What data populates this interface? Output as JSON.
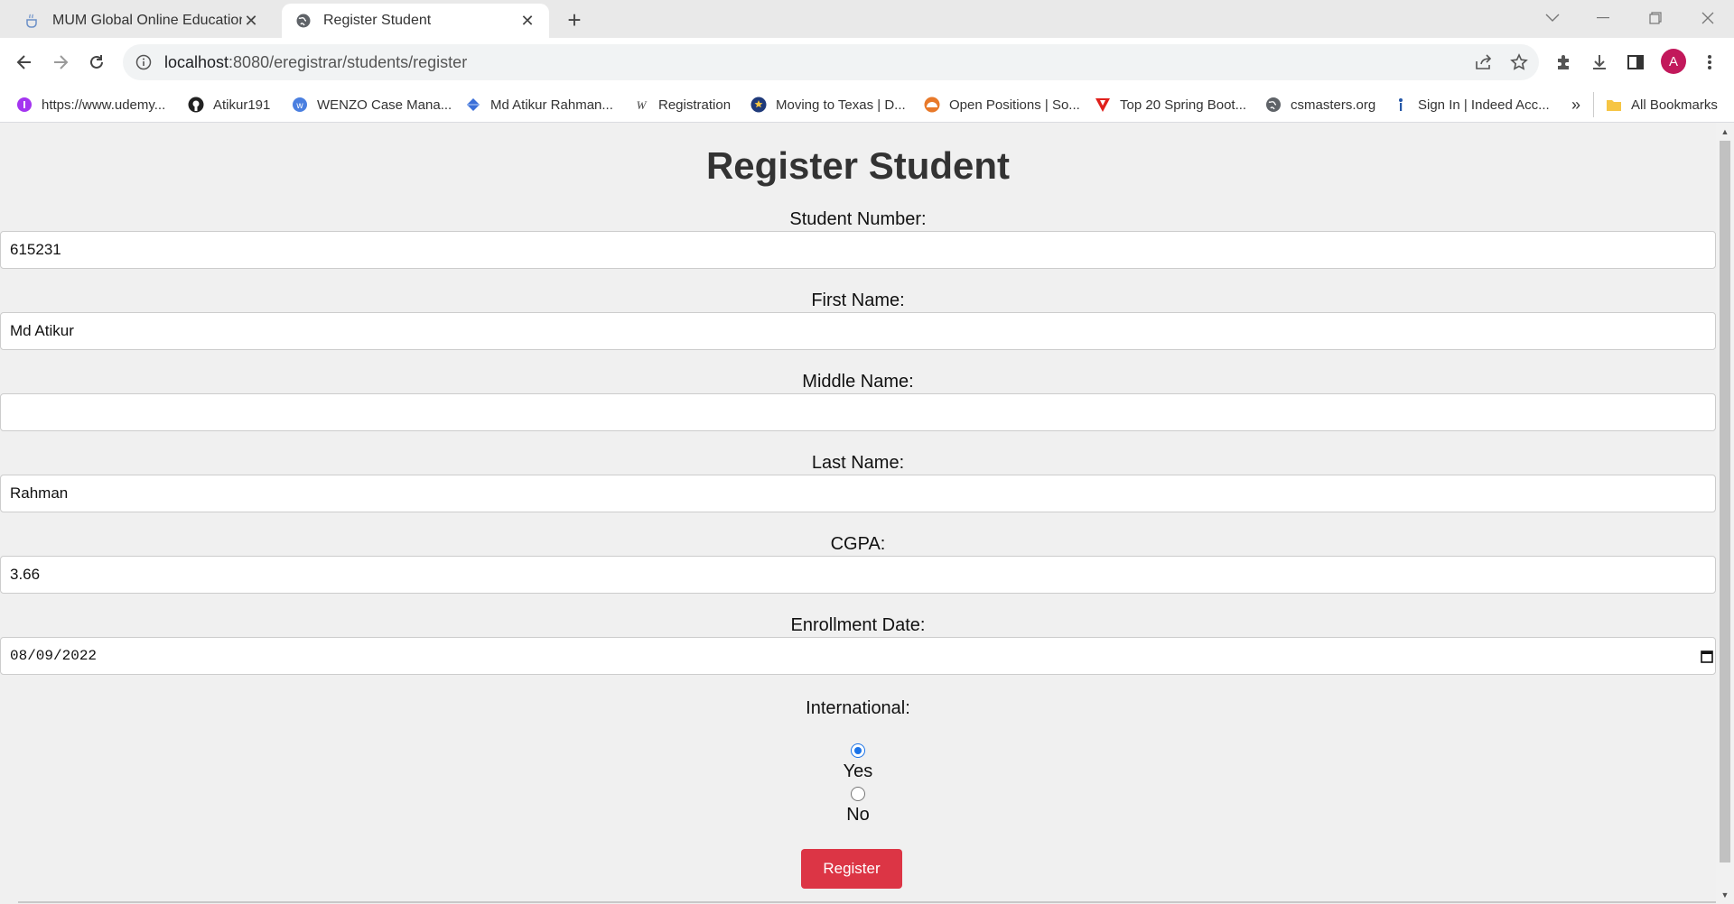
{
  "browser": {
    "tabs": [
      {
        "title": "MUM Global Online Education : C",
        "active": false
      },
      {
        "title": "Register Student",
        "active": true
      }
    ],
    "url_host": "localhost",
    "url_rest": ":8080/eregistrar/students/register",
    "profile_initial": "A",
    "bookmarks": [
      {
        "label": "https://www.udemy...",
        "icon": "udemy-icon"
      },
      {
        "label": "Atikur191",
        "icon": "github-icon"
      },
      {
        "label": "WENZO Case Mana...",
        "icon": "wenzo-icon"
      },
      {
        "label": "Md Atikur Rahman...",
        "icon": "diamond-icon"
      },
      {
        "label": "Registration",
        "icon": "w-logo-icon"
      },
      {
        "label": "Moving to Texas | D...",
        "icon": "star-badge-icon"
      },
      {
        "label": "Open Positions | So...",
        "icon": "sunrise-icon"
      },
      {
        "label": "Top 20 Spring Boot...",
        "icon": "red-v-icon"
      },
      {
        "label": "csmasters.org",
        "icon": "globe-icon"
      },
      {
        "label": "Sign In | Indeed Acc...",
        "icon": "indeed-icon"
      }
    ],
    "bookmarks_overflow": "»",
    "all_bookmarks": "All Bookmarks"
  },
  "page": {
    "title": "Register Student",
    "fields": {
      "student_number": {
        "label": "Student Number:",
        "value": "615231"
      },
      "first_name": {
        "label": "First Name:",
        "value": "Md Atikur"
      },
      "middle_name": {
        "label": "Middle Name:",
        "value": ""
      },
      "last_name": {
        "label": "Last Name:",
        "value": "Rahman"
      },
      "cgpa": {
        "label": "CGPA:",
        "value": "3.66"
      },
      "enrollment_date": {
        "label": "Enrollment Date:",
        "value": "08/09/2022"
      }
    },
    "international": {
      "label": "International:",
      "options": [
        {
          "label": "Yes",
          "checked": true
        },
        {
          "label": "No",
          "checked": false
        }
      ]
    },
    "submit_label": "Register"
  },
  "colors": {
    "submit_bg": "#dc3545",
    "radio_accent": "#1a73e8",
    "page_bg": "#f0f0f0"
  }
}
